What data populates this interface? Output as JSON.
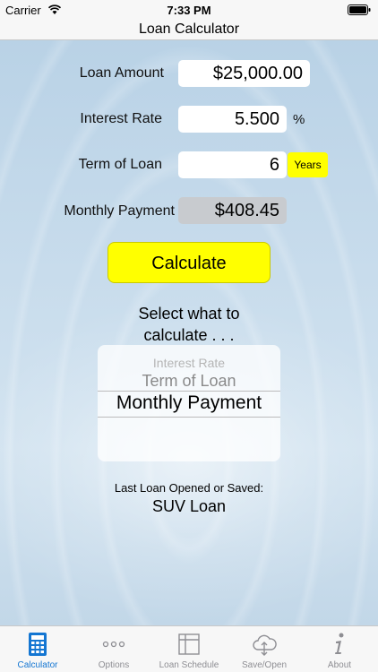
{
  "status_bar": {
    "carrier": "Carrier",
    "time": "7:33 PM"
  },
  "title_bar": {
    "title": "Loan Calculator"
  },
  "form": {
    "loan_amount": {
      "label": "Loan Amount",
      "value": "$25,000.00"
    },
    "interest_rate": {
      "label": "Interest Rate",
      "value": "5.500",
      "unit": "%"
    },
    "term": {
      "label": "Term of Loan",
      "value": "6",
      "unit_button": "Years"
    },
    "monthly_payment": {
      "label": "Monthly Payment",
      "value": "$408.45"
    }
  },
  "calculate_button": "Calculate",
  "picker": {
    "prompt_line1": "Select what to",
    "prompt_line2": "calculate . . .",
    "options": [
      "Interest Rate",
      "Term of Loan",
      "Monthly Payment"
    ],
    "selected": "Monthly Payment"
  },
  "last_loan": {
    "label": "Last Loan Opened or Saved:",
    "value": "SUV Loan"
  },
  "tab_bar": {
    "tabs": [
      {
        "label": "Calculator",
        "icon": "calculator-icon",
        "active": true
      },
      {
        "label": "Options",
        "icon": "more-dots-icon",
        "active": false
      },
      {
        "label": "Loan Schedule",
        "icon": "table-icon",
        "active": false
      },
      {
        "label": "Save/Open",
        "icon": "cloud-icon",
        "active": false
      },
      {
        "label": "About",
        "icon": "info-icon",
        "active": false
      }
    ]
  },
  "colors": {
    "accent_yellow": "#ffff00",
    "active_tab": "#1476d2",
    "inactive_tab": "#8e8e93"
  }
}
